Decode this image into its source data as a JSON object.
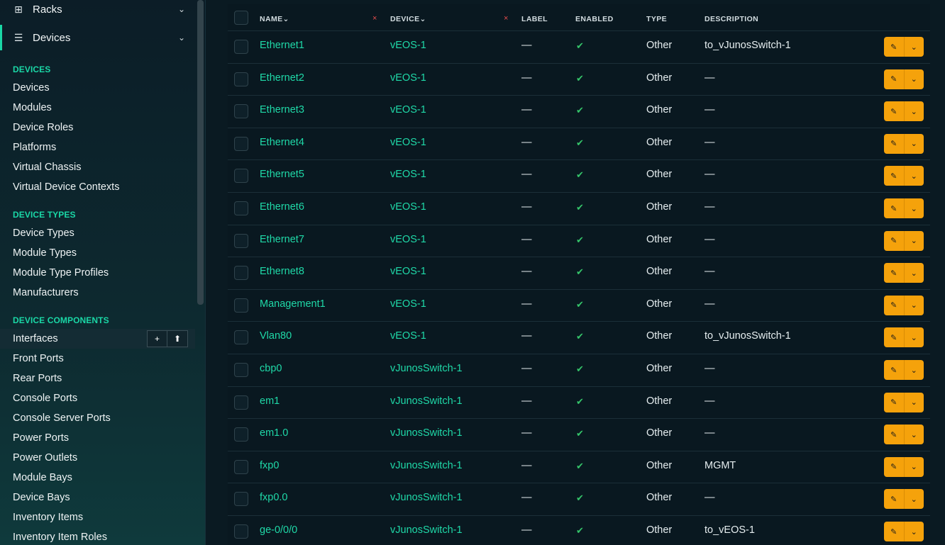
{
  "sidebar": {
    "top_items": [
      {
        "label": "Racks",
        "icon": "grid-icon"
      },
      {
        "label": "Devices",
        "icon": "server-icon"
      }
    ],
    "sections": [
      {
        "title": "DEVICES",
        "items": [
          "Devices",
          "Modules",
          "Device Roles",
          "Platforms",
          "Virtual Chassis",
          "Virtual Device Contexts"
        ]
      },
      {
        "title": "DEVICE TYPES",
        "items": [
          "Device Types",
          "Module Types",
          "Module Type Profiles",
          "Manufacturers"
        ]
      },
      {
        "title": "DEVICE COMPONENTS",
        "items": [
          "Interfaces",
          "Front Ports",
          "Rear Ports",
          "Console Ports",
          "Console Server Ports",
          "Power Ports",
          "Power Outlets",
          "Module Bays",
          "Device Bays",
          "Inventory Items",
          "Inventory Item Roles"
        ]
      }
    ],
    "highlighted_item": "Interfaces",
    "item_buttons": {
      "add": "+",
      "import": "⬆"
    }
  },
  "table": {
    "columns": {
      "name": "NAME",
      "device": "DEVICE",
      "label": "LABEL",
      "enabled": "ENABLED",
      "type": "TYPE",
      "description": "DESCRIPTION"
    },
    "sort_indicator": "⌄",
    "clear_indicator": "×",
    "enabled_mark": "✔",
    "action_icons": {
      "edit": "✎",
      "dropdown": "⌄"
    },
    "rows": [
      {
        "name": "Ethernet1",
        "device": "vEOS-1",
        "label": "—",
        "type": "Other",
        "description": "to_vJunosSwitch-1"
      },
      {
        "name": "Ethernet2",
        "device": "vEOS-1",
        "label": "—",
        "type": "Other",
        "description": "—"
      },
      {
        "name": "Ethernet3",
        "device": "vEOS-1",
        "label": "—",
        "type": "Other",
        "description": "—"
      },
      {
        "name": "Ethernet4",
        "device": "vEOS-1",
        "label": "—",
        "type": "Other",
        "description": "—"
      },
      {
        "name": "Ethernet5",
        "device": "vEOS-1",
        "label": "—",
        "type": "Other",
        "description": "—"
      },
      {
        "name": "Ethernet6",
        "device": "vEOS-1",
        "label": "—",
        "type": "Other",
        "description": "—"
      },
      {
        "name": "Ethernet7",
        "device": "vEOS-1",
        "label": "—",
        "type": "Other",
        "description": "—"
      },
      {
        "name": "Ethernet8",
        "device": "vEOS-1",
        "label": "—",
        "type": "Other",
        "description": "—"
      },
      {
        "name": "Management1",
        "device": "vEOS-1",
        "label": "—",
        "type": "Other",
        "description": "—"
      },
      {
        "name": "Vlan80",
        "device": "vEOS-1",
        "label": "—",
        "type": "Other",
        "description": "to_vJunosSwitch-1"
      },
      {
        "name": "cbp0",
        "device": "vJunosSwitch-1",
        "label": "—",
        "type": "Other",
        "description": "—"
      },
      {
        "name": "em1",
        "device": "vJunosSwitch-1",
        "label": "—",
        "type": "Other",
        "description": "—"
      },
      {
        "name": "em1.0",
        "device": "vJunosSwitch-1",
        "label": "—",
        "type": "Other",
        "description": "—"
      },
      {
        "name": "fxp0",
        "device": "vJunosSwitch-1",
        "label": "—",
        "type": "Other",
        "description": "MGMT"
      },
      {
        "name": "fxp0.0",
        "device": "vJunosSwitch-1",
        "label": "—",
        "type": "Other",
        "description": "—"
      },
      {
        "name": "ge-0/0/0",
        "device": "vJunosSwitch-1",
        "label": "—",
        "type": "Other",
        "description": "to_vEOS-1"
      }
    ]
  },
  "colors": {
    "accent": "#1ad7a6",
    "link": "#1fd9a8",
    "check": "#35c56a",
    "action": "#f5a20b",
    "clear": "#e84d4d"
  }
}
